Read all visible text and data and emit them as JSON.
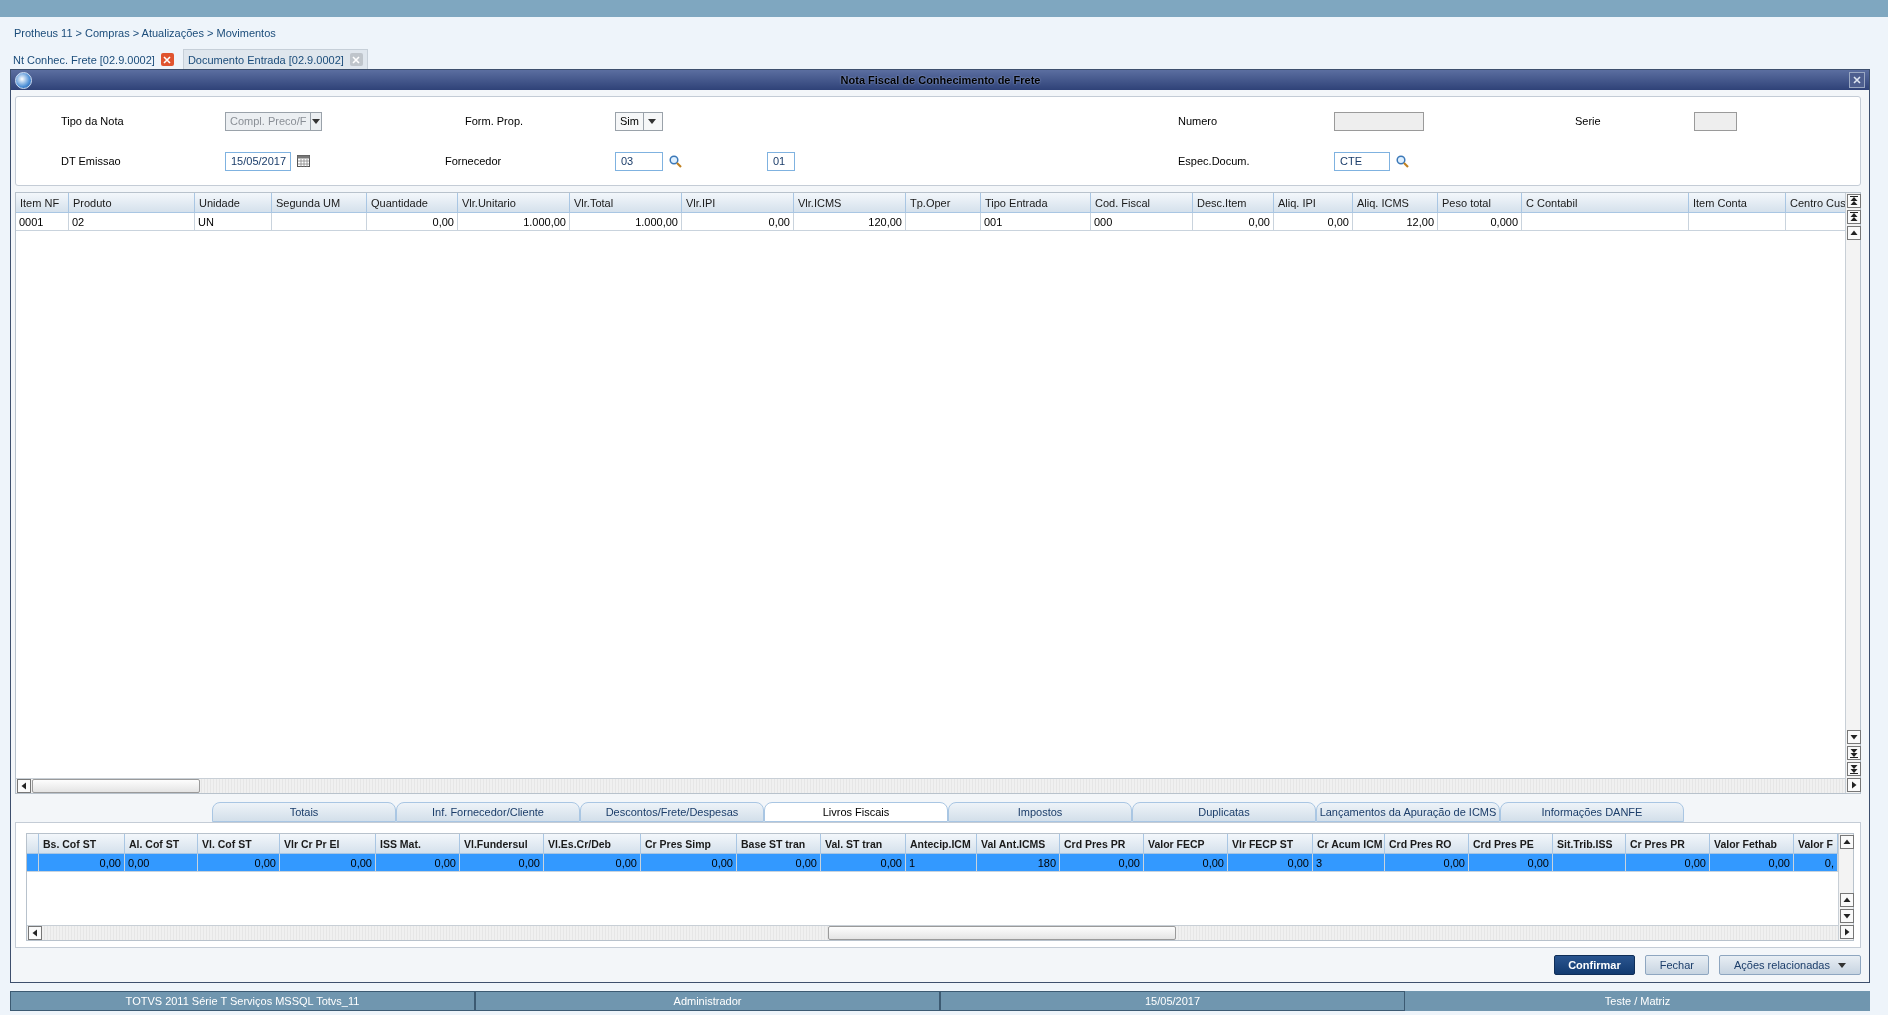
{
  "breadcrumb": "Protheus 11 > Compras  > Atualizações > Movimentos",
  "tabs": [
    {
      "label": "Nt Conhec. Frete [02.9.0002]",
      "selected": true
    },
    {
      "label": "Documento Entrada [02.9.0002]",
      "selected": false
    }
  ],
  "window": {
    "title": "Nota Fiscal de Conhecimento de Frete"
  },
  "form": {
    "tipo_da_nota": {
      "label": "Tipo da Nota",
      "value": "Compl. Preco/F",
      "disabled": true
    },
    "form_prop": {
      "label": "Form. Prop.",
      "value": "Sim",
      "disabled": false
    },
    "numero": {
      "label": "Numero"
    },
    "serie": {
      "label": "Serie"
    },
    "dt_emissao": {
      "label": "DT Emissao",
      "value": "15/05/2017"
    },
    "fornecedor": {
      "label": "Fornecedor",
      "value": "03",
      "loja": "01"
    },
    "espec_docum": {
      "label": "Espec.Docum.",
      "value": "CTE"
    }
  },
  "items_table": {
    "columns": [
      {
        "label": "Item NF",
        "numeric": false
      },
      {
        "label": "Produto",
        "numeric": false
      },
      {
        "label": "Unidade",
        "numeric": false
      },
      {
        "label": "Segunda UM"
      },
      {
        "label": "Quantidade",
        "numeric": true
      },
      {
        "label": "Vlr.Unitario",
        "numeric": true
      },
      {
        "label": "Vlr.Total",
        "numeric": true
      },
      {
        "label": "Vlr.IPI",
        "numeric": true
      },
      {
        "label": "Vlr.ICMS",
        "numeric": true
      },
      {
        "label": "Tp.Oper"
      },
      {
        "label": "Tipo Entrada",
        "numeric": false
      },
      {
        "label": "Cod. Fiscal",
        "numeric": false
      },
      {
        "label": "Desc.Item",
        "numeric": true
      },
      {
        "label": "Aliq. IPI",
        "numeric": true
      },
      {
        "label": "Aliq. ICMS",
        "numeric": true
      },
      {
        "label": "Peso total",
        "numeric": true
      },
      {
        "label": "C Contabil"
      },
      {
        "label": "Item Conta"
      },
      {
        "label": "Centro Cus"
      }
    ],
    "rows": [
      [
        "0001",
        "02",
        "UN",
        "",
        "0,00",
        "1.000,00",
        "1.000,00",
        "0,00",
        "120,00",
        "",
        "001",
        "000",
        "0,00",
        "0,00",
        "12,00",
        "0,000",
        "",
        "",
        ""
      ]
    ]
  },
  "folder_tabs": [
    {
      "label": "Totais",
      "selected": false
    },
    {
      "label": "Inf. Fornecedor/Cliente",
      "selected": false
    },
    {
      "label": "Descontos/Frete/Despesas",
      "selected": false
    },
    {
      "label": "Livros Fiscais",
      "selected": true
    },
    {
      "label": "Impostos",
      "selected": false
    },
    {
      "label": "Duplicatas",
      "selected": false
    },
    {
      "label": "Lançamentos da Apuração de ICMS",
      "selected": false
    },
    {
      "label": "Informações DANFE",
      "selected": false
    }
  ],
  "fiscal_table": {
    "columns": [
      {
        "label": "Bs. Cof ST",
        "numeric": true
      },
      {
        "label": "Al. Cof ST",
        "numeric": false
      },
      {
        "label": "Vl. Cof ST",
        "numeric": true
      },
      {
        "label": "Vlr Cr Pr El",
        "numeric": true
      },
      {
        "label": "ISS Mat.",
        "numeric": true
      },
      {
        "label": "Vl.Fundersul",
        "numeric": true
      },
      {
        "label": "Vl.Es.Cr/Deb",
        "numeric": true
      },
      {
        "label": "Cr Pres Simp",
        "numeric": true
      },
      {
        "label": "Base ST tran",
        "numeric": true
      },
      {
        "label": "Val. ST tran",
        "numeric": true
      },
      {
        "label": "Antecip.ICM",
        "numeric": false
      },
      {
        "label": "Val Ant.ICMS",
        "numeric": true
      },
      {
        "label": "Crd Pres PR",
        "numeric": true
      },
      {
        "label": "Valor FECP",
        "numeric": true
      },
      {
        "label": "Vlr FECP ST",
        "numeric": true
      },
      {
        "label": "Cr Acum ICM",
        "numeric": false
      },
      {
        "label": "Crd Pres RO",
        "numeric": true
      },
      {
        "label": "Crd Pres PE",
        "numeric": true
      },
      {
        "label": "Sit.Trib.ISS"
      },
      {
        "label": "Cr Pres PR",
        "numeric": true
      },
      {
        "label": "Valor Fethab",
        "numeric": true
      },
      {
        "label": "Valor F",
        "numeric": true
      }
    ],
    "rows": [
      {
        "selected": true,
        "cells": [
          "0,00",
          "0,00",
          "0,00",
          "0,00",
          "0,00",
          "0,00",
          "0,00",
          "0,00",
          "0,00",
          "0,00",
          "1",
          "180",
          "0,00",
          "0,00",
          "0,00",
          "3",
          "0,00",
          "0,00",
          "",
          "0,00",
          "0,00",
          "0,"
        ]
      }
    ]
  },
  "buttons": [
    {
      "label": "Confirmar",
      "kind": "primary"
    },
    {
      "label": "Fechar",
      "kind": "secondary"
    },
    {
      "label": "Ações relacionadas",
      "kind": "menu"
    }
  ],
  "status_bar": [
    "TOTVS 2011 Série T Serviços MSSQL Totvs_11",
    "Administrador",
    "15/05/2017",
    "Teste / Matriz"
  ]
}
